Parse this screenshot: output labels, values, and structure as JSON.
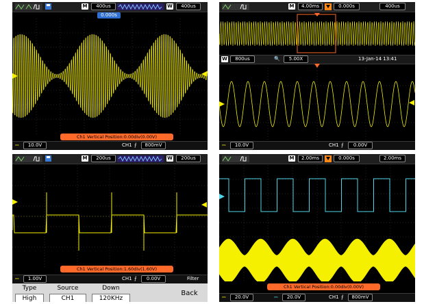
{
  "colors": {
    "yellow": "#f5f000",
    "cyan": "#4fd6ea",
    "orange": "#ff6a2a",
    "blue": "#2f6fd0"
  },
  "panels": [
    {
      "timebase_label": "400us",
      "wave_label": "400us",
      "trigger_time": "0.000s",
      "status": "Ch1 Vertical Position:0.00div(0.00V)",
      "ch1_scale": "10.0V",
      "trig_ch": "CH1",
      "trig_level": "800mV"
    },
    {
      "timebase_label": "4.00ms",
      "trigger_delay": "0.000s",
      "wave_label": "400us",
      "window_label": "800us",
      "zoom": "5.00X",
      "datetime": "13-Jan-14 13:41",
      "ch1_scale": "10.0V",
      "trig_ch": "CH1",
      "trig_level": "0.00V"
    },
    {
      "timebase_label": "200us",
      "wave_label": "200us",
      "status": "Ch1 Vertical Position:1.60div(1.60V)",
      "ch1_scale": "1.00V",
      "trig_ch": "CH1",
      "trig_level": "0.00V",
      "menu": {
        "title": "Filter",
        "items": [
          {
            "title": "Type",
            "value": "High Pass"
          },
          {
            "title": "Source",
            "value": "CH1"
          },
          {
            "title": "Down",
            "value": "120KHz"
          }
        ],
        "back": "Back"
      }
    },
    {
      "timebase_label": "2.00ms",
      "trigger_delay": "0.000s",
      "wave_label": "2.00ms",
      "status": "Ch1 Vertical Position:0.00div(0.00V)",
      "ch1_scale": "20.0V",
      "ch2_scale": "20.0V",
      "trig_ch": "CH1",
      "trig_level": "800mV"
    }
  ]
}
